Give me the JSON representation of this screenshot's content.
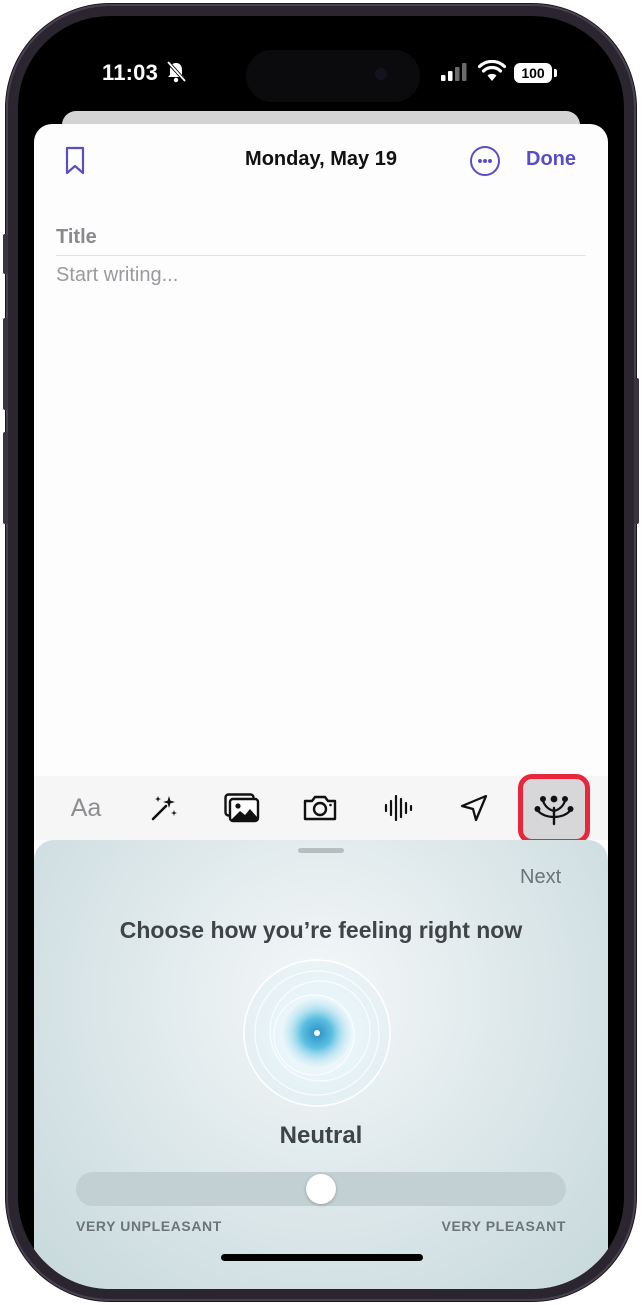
{
  "status_bar": {
    "time": "11:03",
    "battery": "100"
  },
  "header": {
    "date": "Monday, May 19",
    "done_label": "Done"
  },
  "editor": {
    "title_placeholder": "Title",
    "body_placeholder": "Start writing..."
  },
  "toolbar": {
    "text_format_label": "Aa",
    "items": [
      "text-format",
      "magic-wand",
      "photo-library",
      "camera",
      "audio-waveform",
      "location-arrow",
      "state-of-mind"
    ]
  },
  "mood_picker": {
    "next_label": "Next",
    "prompt": "Choose how you’re feeling right now",
    "mood": "Neutral",
    "slider_value": 0.5,
    "min_label": "VERY UNPLEASANT",
    "max_label": "VERY PLEASANT"
  },
  "colors": {
    "accent": "#5b4ec5",
    "highlight": "#e8273d",
    "panel_bg": "#dfe9eb",
    "orb": "#4cb3d8"
  }
}
